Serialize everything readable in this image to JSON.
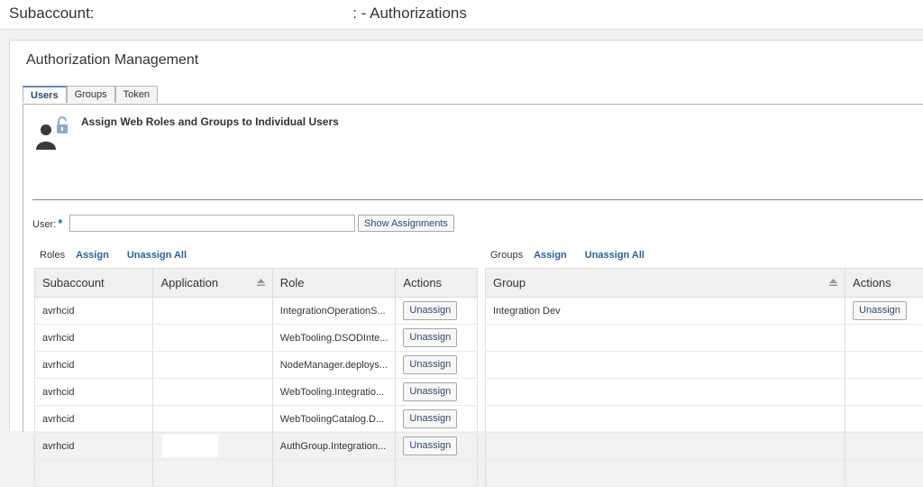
{
  "page": {
    "title_prefix": "Subaccount:",
    "title_suffix": ": - Authorizations"
  },
  "panel": {
    "title": "Authorization Management",
    "tabs": [
      {
        "label": "Users",
        "active": true
      },
      {
        "label": "Groups",
        "active": false
      },
      {
        "label": "Token",
        "active": false
      }
    ],
    "heading": "Assign Web Roles and Groups to Individual Users",
    "user_label": "User:",
    "user_required": "*",
    "user_value": "",
    "show_button": "Show Assignments"
  },
  "roles": {
    "label": "Roles",
    "assign": "Assign",
    "unassign_all": "Unassign All",
    "columns": [
      "Subaccount",
      "Application",
      "Role",
      "Actions"
    ],
    "rows": [
      {
        "subaccount": "avrhcid",
        "application": "",
        "role": "IntegrationOperationS...",
        "action": "Unassign"
      },
      {
        "subaccount": "avrhcid",
        "application": "",
        "role": "WebTooling.DSODInte...",
        "action": "Unassign"
      },
      {
        "subaccount": "avrhcid",
        "application": "",
        "role": "NodeManager.deploys...",
        "action": "Unassign"
      },
      {
        "subaccount": "avrhcid",
        "application": "",
        "role": "WebTooling.Integratio...",
        "action": "Unassign"
      },
      {
        "subaccount": "avrhcid",
        "application": "",
        "role": "WebToolingCatalog.D...",
        "action": "Unassign"
      },
      {
        "subaccount": "avrhcid",
        "application": "",
        "role": "AuthGroup.Integration...",
        "action": "Unassign"
      }
    ]
  },
  "groups": {
    "label": "Groups",
    "assign": "Assign",
    "unassign_all": "Unassign All",
    "columns": [
      "Group",
      "Actions"
    ],
    "rows": [
      {
        "group": "Integration Dev",
        "action": "Unassign"
      }
    ]
  },
  "colors": {
    "link": "#2b5f9e",
    "required": "#2a5ea6",
    "header_bg": "#f0f0f0"
  }
}
